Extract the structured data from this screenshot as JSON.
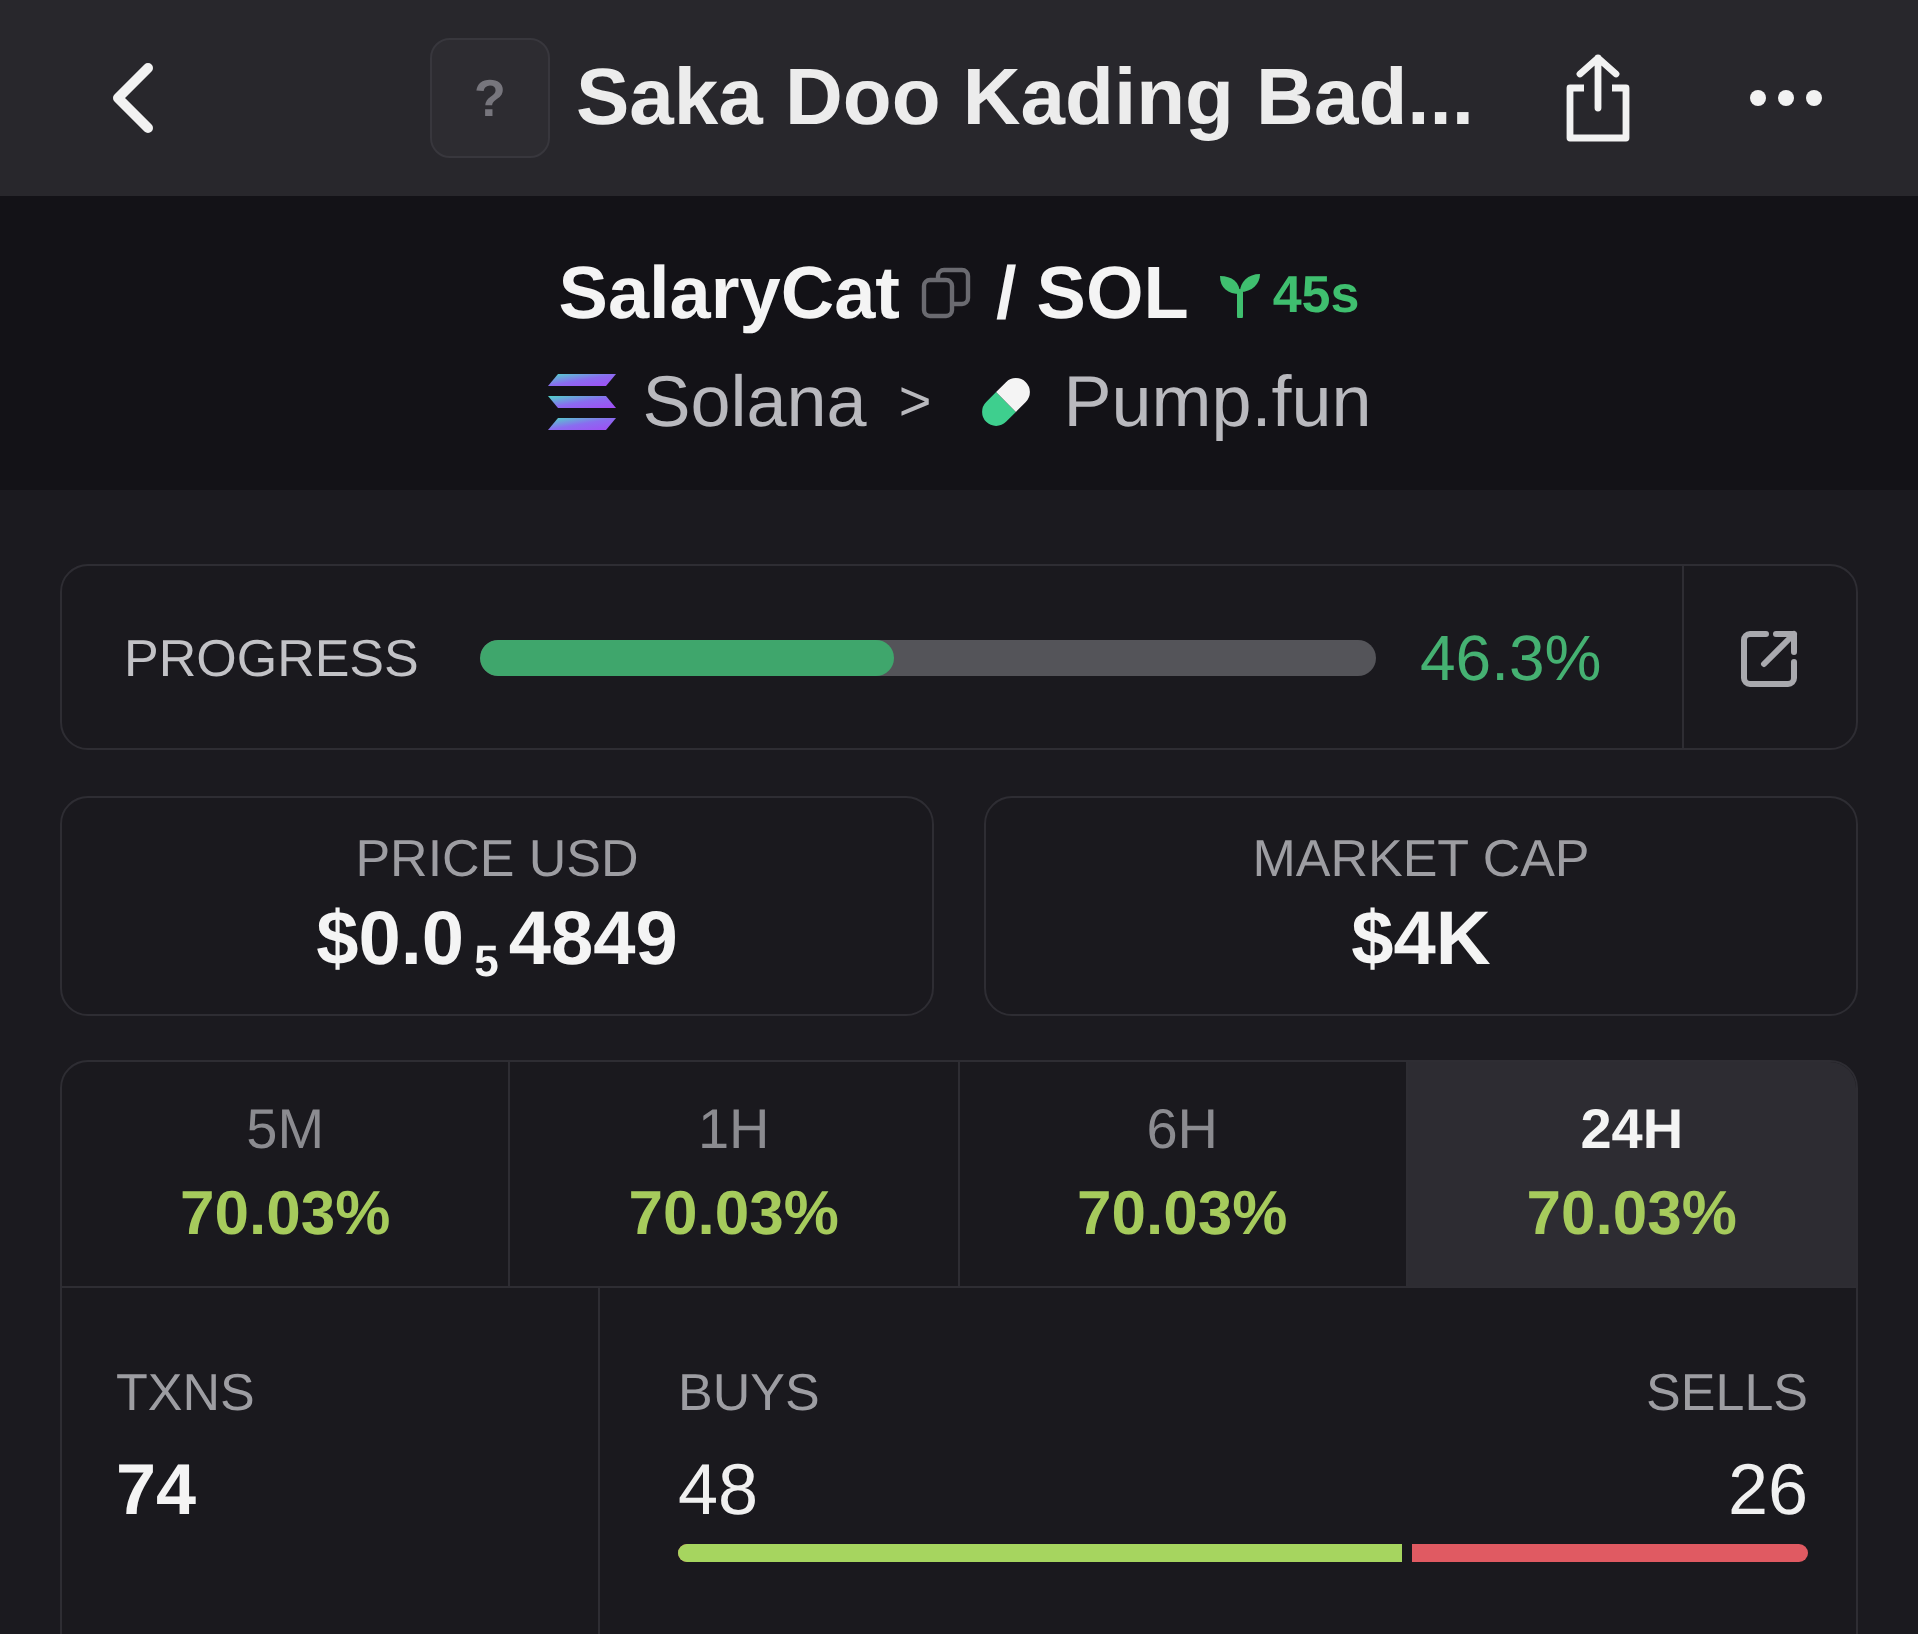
{
  "top_bar": {
    "avatar_glyph": "?",
    "title": "Saka Doo Kading Bad..."
  },
  "pair": {
    "base": "SalaryCat",
    "separator": "/",
    "quote": "SOL",
    "age": "45s"
  },
  "breadcrumb": {
    "chain": "Solana",
    "separator": ">",
    "platform": "Pump.fun"
  },
  "progress": {
    "label": "PROGRESS",
    "level": 0.463,
    "reading": "46.3%"
  },
  "stats": [
    {
      "label": "PRICE USD",
      "value": "$0.0$_{5}$4849"
    },
    {
      "label": "MARKET CAP",
      "value": "$4K"
    }
  ],
  "timeframes": [
    {
      "label": "5M",
      "change": "70.03%",
      "selected": false
    },
    {
      "label": "1H",
      "change": "70.03%",
      "selected": false
    },
    {
      "label": "6H",
      "change": "70.03%",
      "selected": false
    },
    {
      "label": "24H",
      "change": "70.03%",
      "selected": true
    }
  ],
  "transactions": {
    "label": "TXNS",
    "value": "74",
    "buys_label": "BUYS",
    "buys": "48",
    "sells_label": "SELLS",
    "sells": "26",
    "level": 0.649
  }
}
